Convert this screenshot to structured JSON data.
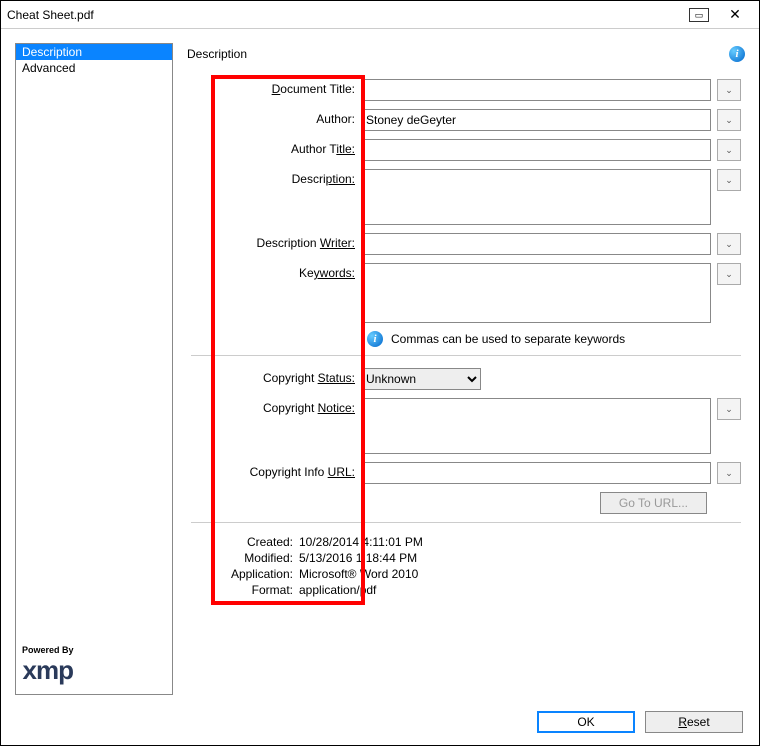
{
  "window": {
    "title": "Cheat Sheet.pdf"
  },
  "sidebar": {
    "items": [
      {
        "label": "Description",
        "selected": true
      },
      {
        "label": "Advanced",
        "selected": false
      }
    ]
  },
  "panel": {
    "title": "Description"
  },
  "labels": {
    "doc_title_pre": "D",
    "doc_title_post": "ocument Title:",
    "author": "Author:",
    "author_title_pre": "Author T",
    "author_title_post": "itle:",
    "description_pre": "Descri",
    "description_post": "ption:",
    "desc_writer_pre": "Description ",
    "desc_writer_post": "Writer:",
    "keywords_pre": "Ke",
    "keywords_post": "ywords:",
    "copyright_status_pre": "Copyright ",
    "copyright_status_post": "Status:",
    "copyright_notice_pre": "Copyright ",
    "copyright_notice_post": "Notice:",
    "copyright_url_pre": "Copyright Info ",
    "copyright_url_post": "URL:"
  },
  "values": {
    "doc_title": "",
    "author": "Stoney deGeyter",
    "author_title": "",
    "description": "",
    "desc_writer": "",
    "keywords": "",
    "copyright_status": "Unknown",
    "copyright_notice": "",
    "copyright_url": ""
  },
  "hint": "Commas can be used to separate keywords",
  "go_to_url": "Go To URL...",
  "meta": {
    "created_label": "Created:",
    "created_value": "10/28/2014 4:11:01 PM",
    "modified_label": "Modified:",
    "modified_value": "5/13/2016 1:18:44 PM",
    "application_label": "Application:",
    "application_value": "Microsoft® Word 2010",
    "format_label": "Format:",
    "format_value": "application/pdf"
  },
  "buttons": {
    "ok": "OK",
    "reset_pre": "R",
    "reset_post": "eset"
  },
  "logo": {
    "powered": "Powered By",
    "name": "xmp"
  }
}
